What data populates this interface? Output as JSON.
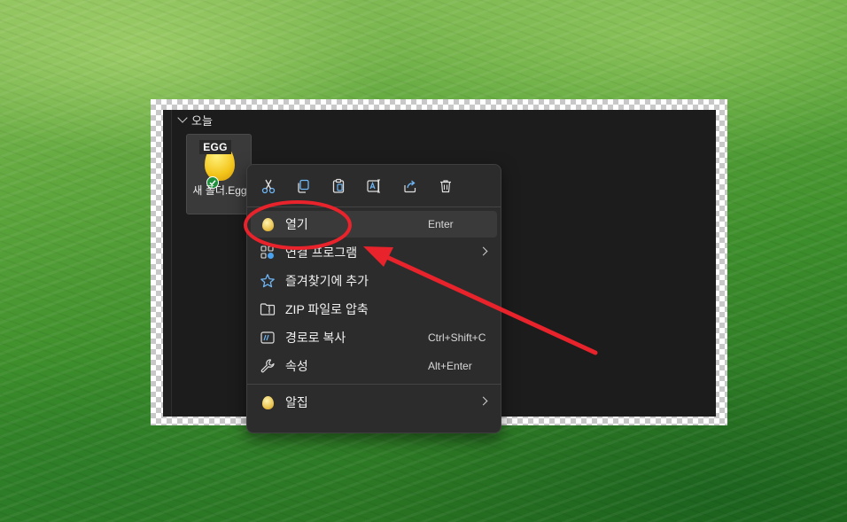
{
  "explorer": {
    "group_label": "오늘",
    "file": {
      "icon_text": "EGG",
      "name": "새 폴더.Egg"
    }
  },
  "context_menu": {
    "toolbar": [
      {
        "icon": "cut-icon"
      },
      {
        "icon": "copy-icon"
      },
      {
        "icon": "paste-icon"
      },
      {
        "icon": "rename-icon"
      },
      {
        "icon": "share-icon"
      },
      {
        "icon": "delete-icon"
      }
    ],
    "items": [
      {
        "label": "열기",
        "shortcut": "Enter",
        "icon": "egg-icon"
      },
      {
        "label": "연결 프로그램",
        "icon": "open-with-icon",
        "submenu": true
      },
      {
        "label": "즐겨찾기에 추가",
        "icon": "star-icon"
      },
      {
        "label": "ZIP 파일로 압축",
        "icon": "zip-folder-icon"
      },
      {
        "label": "경로로 복사",
        "shortcut": "Ctrl+Shift+C",
        "icon": "copy-path-icon"
      },
      {
        "label": "속성",
        "shortcut": "Alt+Enter",
        "icon": "wrench-icon"
      },
      {
        "label": "알집",
        "icon": "egg-icon",
        "submenu": true
      }
    ]
  },
  "colors": {
    "annotation": "#e8232b",
    "accent": "#4aa3f0"
  }
}
